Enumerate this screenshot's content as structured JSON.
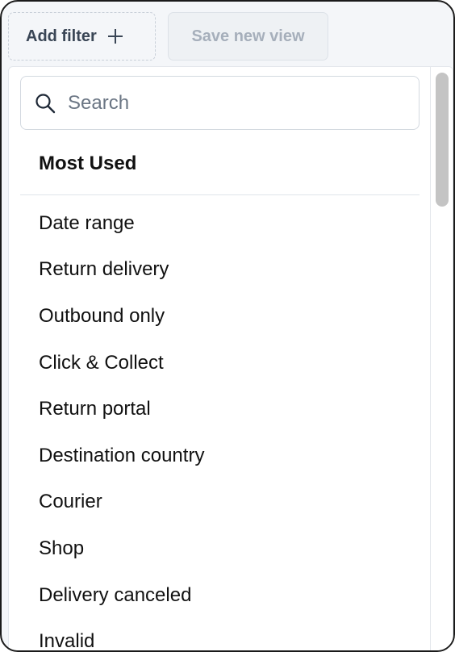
{
  "toolbar": {
    "add_filter_label": "Add filter",
    "add_filter_icon": "plus-icon",
    "save_view_label": "Save new view"
  },
  "search": {
    "placeholder": "Search",
    "value": "",
    "icon": "search-icon"
  },
  "section": {
    "title": "Most Used"
  },
  "filters": [
    {
      "label": "Date range"
    },
    {
      "label": "Return delivery"
    },
    {
      "label": "Outbound only"
    },
    {
      "label": "Click & Collect"
    },
    {
      "label": "Return portal"
    },
    {
      "label": "Destination country"
    },
    {
      "label": "Courier"
    },
    {
      "label": "Shop"
    },
    {
      "label": "Delivery canceled"
    },
    {
      "label": "Invalid"
    }
  ],
  "colors": {
    "background": "#f4f6f9",
    "text": "#111111",
    "muted_text": "#a6afbb",
    "border": "#d3d9e0"
  }
}
